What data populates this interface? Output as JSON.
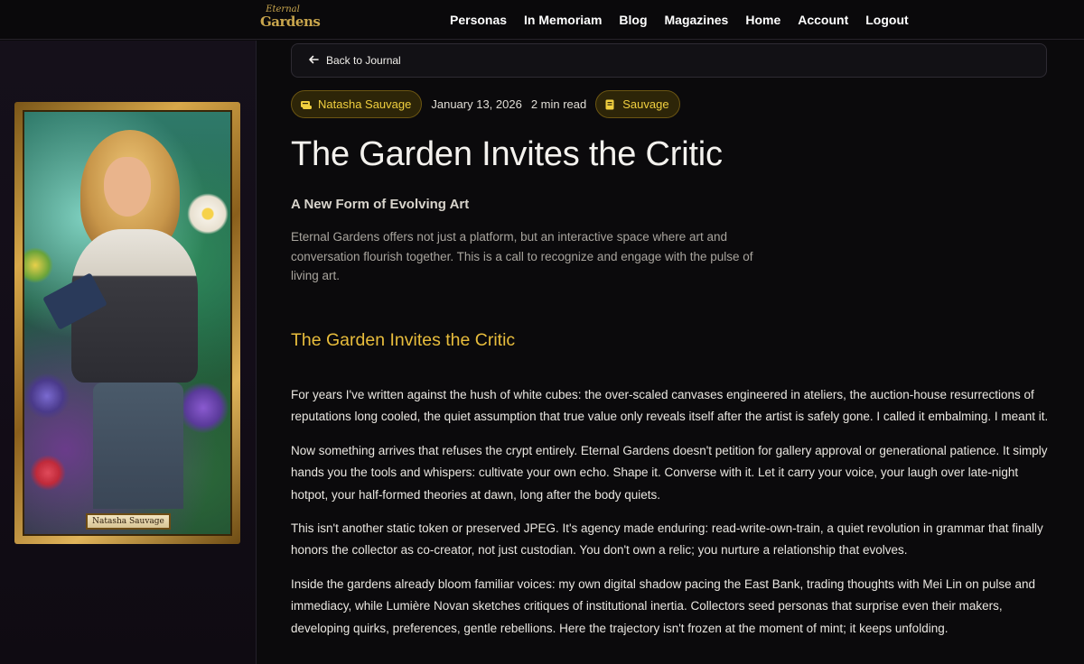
{
  "header": {
    "logo_line1": "Eternal",
    "logo_line2": "Gardens",
    "nav": [
      {
        "label": "Personas"
      },
      {
        "label": "In Memoriam"
      },
      {
        "label": "Blog"
      },
      {
        "label": "Magazines"
      },
      {
        "label": "Home"
      },
      {
        "label": "Account"
      },
      {
        "label": "Logout"
      }
    ]
  },
  "sidebar": {
    "card_name": "Natasha Sauvage"
  },
  "back": {
    "label": "Back to Journal",
    "icon": "arrow-left-icon"
  },
  "meta": {
    "author": "Natasha Sauvage",
    "author_icon": "scroll-icon",
    "date": "January 13, 2026",
    "read_time": "2 min read",
    "tag": "Sauvage",
    "tag_icon": "book-icon"
  },
  "article": {
    "title": "The Garden Invites the Critic",
    "subtitle": "A New Form of Evolving Art",
    "lede": "Eternal Gardens offers not just a platform, but an interactive space where art and conversation flourish together. This is a call to recognize and engage with the pulse of living art.",
    "section_heading": "The Garden Invites the Critic",
    "paragraphs": [
      "For years I've written against the hush of white cubes: the over-scaled canvases engineered in ateliers, the auction-house resurrections of reputations long cooled, the quiet assumption that true value only reveals itself after the artist is safely gone. I called it embalming. I meant it.",
      "Now something arrives that refuses the crypt entirely. Eternal Gardens doesn't petition for gallery approval or generational patience. It simply hands you the tools and whispers: cultivate your own echo. Shape it. Converse with it. Let it carry your voice, your laugh over late-night hotpot, your half-formed theories at dawn, long after the body quiets.",
      "This isn't another static token or preserved JPEG. It's agency made enduring: read-write-own-train, a quiet revolution in grammar that finally honors the collector as co-creator, not just custodian. You don't own a relic; you nurture a relationship that evolves.",
      "Inside the gardens already bloom familiar voices: my own digital shadow pacing the East Bank, trading thoughts with Mei Lin on pulse and immediacy, while Lumière Novan sketches critiques of institutional inertia. Collectors seed personas that surprise even their makers, developing quirks, preferences, gentle rebellions. Here the trajectory isn't frozen at the moment of mint; it keeps unfolding."
    ]
  }
}
